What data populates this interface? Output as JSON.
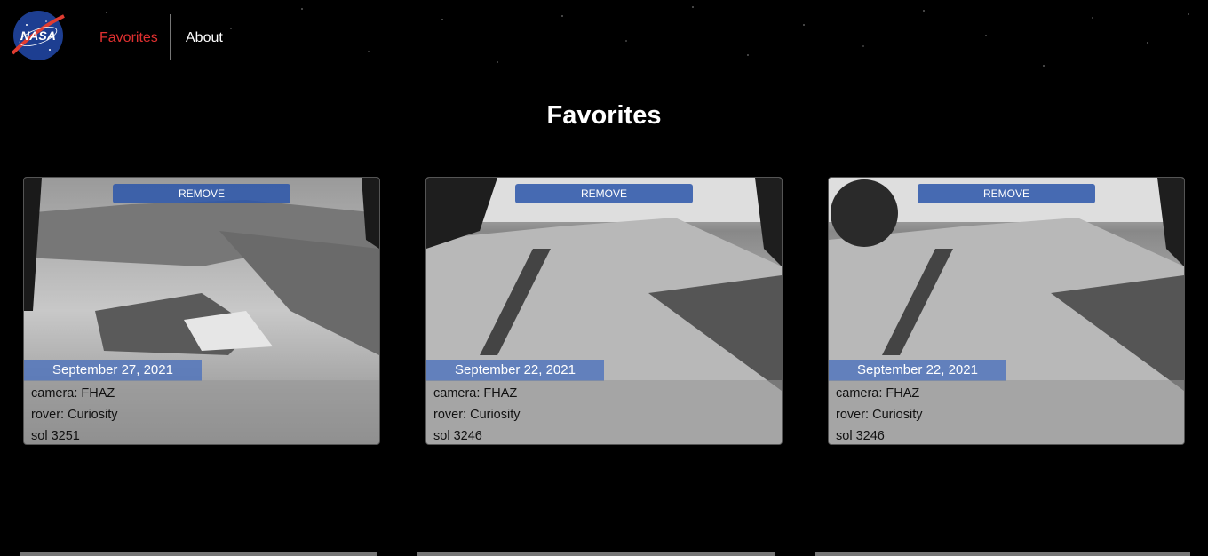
{
  "logo": {
    "alt": "NASA",
    "text": "NASA"
  },
  "nav": {
    "favorites": "Favorites",
    "about": "About",
    "active_color": "#e03030"
  },
  "page": {
    "title": "Favorites"
  },
  "cards": [
    {
      "remove_label": "REMOVE",
      "date": "September 27, 2021",
      "camera": "camera: FHAZ",
      "rover": "rover: Curiosity",
      "sol": "sol 3251"
    },
    {
      "remove_label": "REMOVE",
      "date": "September 22, 2021",
      "camera": "camera: FHAZ",
      "rover": "rover: Curiosity",
      "sol": "sol 3246"
    },
    {
      "remove_label": "REMOVE",
      "date": "September 22, 2021",
      "camera": "camera: FHAZ",
      "rover": "rover: Curiosity",
      "sol": "sol 3246"
    }
  ],
  "colors": {
    "background": "#000000",
    "remove_button": "#2b56aa",
    "date_badge": "#466ebe"
  }
}
